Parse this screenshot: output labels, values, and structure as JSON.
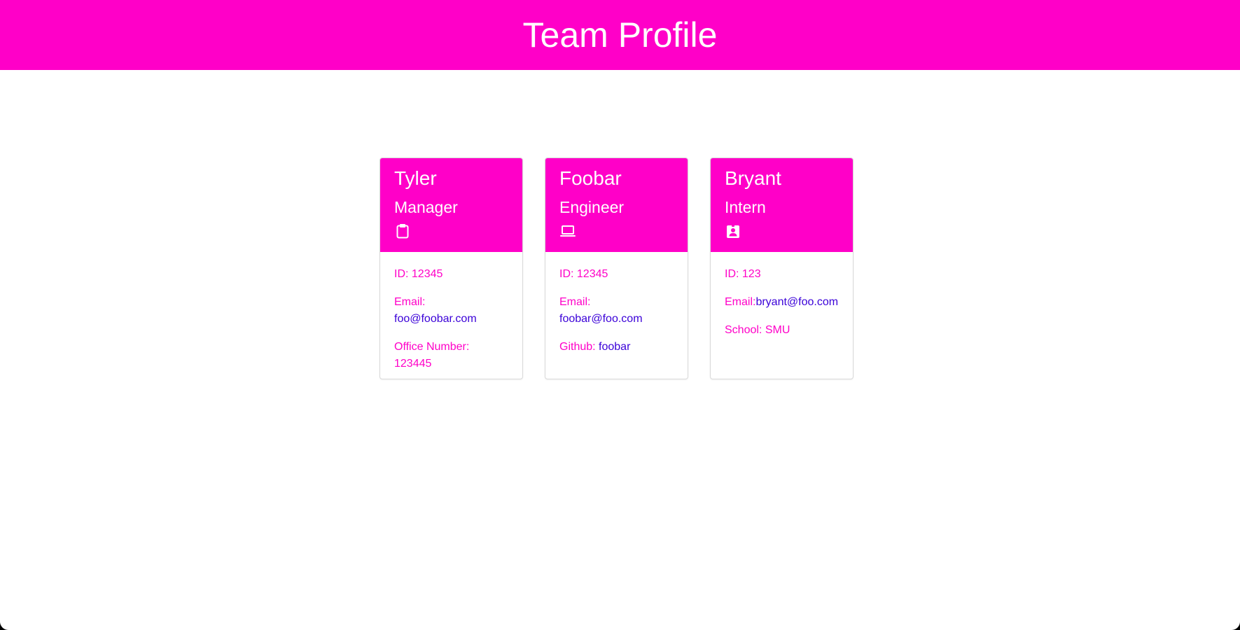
{
  "header": {
    "title": "Team Profile"
  },
  "colors": {
    "accent": "#ff00c8",
    "link": "#3a00d8",
    "text_on_accent": "#ffffff"
  },
  "cards": [
    {
      "name": "Tyler",
      "role": "Manager",
      "icon": "clipboard-icon",
      "id_label": "ID: ",
      "id": "12345",
      "email_label": "Email:",
      "email": "foo@foobar.com",
      "extra_label": "Office Number: ",
      "extra_value": "123445"
    },
    {
      "name": "Foobar",
      "role": "Engineer",
      "icon": "laptop-icon",
      "id_label": "ID: ",
      "id": "12345",
      "email_label": "Email:",
      "email": "foobar@foo.com",
      "extra_label": "Github: ",
      "extra_value": "foobar"
    },
    {
      "name": "Bryant",
      "role": "Intern",
      "icon": "id-badge-icon",
      "id_label": "ID: ",
      "id": "123",
      "email_label": "Email:",
      "email": "bryant@foo.com",
      "extra_label": "School: ",
      "extra_value": "SMU"
    }
  ]
}
